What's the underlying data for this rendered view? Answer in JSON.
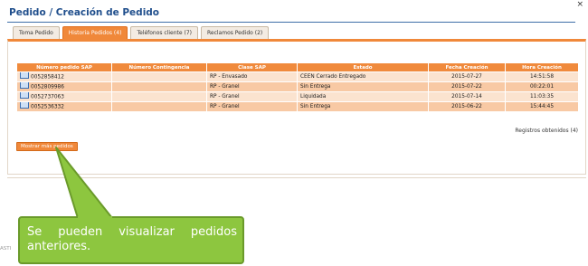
{
  "header": {
    "title": "Pedido / Creación de Pedido",
    "corner_mark": "×"
  },
  "tabs": [
    {
      "label": "Toma Pedido",
      "active": false
    },
    {
      "label": "Historia Pedidos (4)",
      "active": true
    },
    {
      "label": "Teléfonos cliente (7)",
      "active": false
    },
    {
      "label": "Reclamos Pedido (2)",
      "active": false
    }
  ],
  "table": {
    "columns": [
      "Número pedido SAP",
      "Número Contingencia",
      "Clase SAP",
      "Estado",
      "Fecha Creación",
      "Hora Creación"
    ],
    "rows": [
      {
        "sap": "0052858412",
        "contingencia": "",
        "clase": "RP - Envasado",
        "estado": "CEEN Cerrado Entregado",
        "fecha": "2015-07-27",
        "hora": "14:51:58"
      },
      {
        "sap": "0052809986",
        "contingencia": "",
        "clase": "RP - Granel",
        "estado": "Sin Entrega",
        "fecha": "2015-07-22",
        "hora": "00:22:01"
      },
      {
        "sap": "0052737063",
        "contingencia": "",
        "clase": "RP - Granel",
        "estado": "Liquidada",
        "fecha": "2015-07-14",
        "hora": "11:03:35"
      },
      {
        "sap": "0052536332",
        "contingencia": "",
        "clase": "RP - Granel",
        "estado": "Sin Entrega",
        "fecha": "2015-06-22",
        "hora": "15:44:45"
      }
    ]
  },
  "records_label": "Registros obtenidos (4)",
  "more_button": "Mostrar más pedidos",
  "side_text": "ASTI",
  "callout": {
    "text": "Se pueden visualizar pedidos anteriores.",
    "color": "#8dc63f"
  },
  "colors": {
    "accent": "#f0883a",
    "title": "#1f4e8c"
  }
}
